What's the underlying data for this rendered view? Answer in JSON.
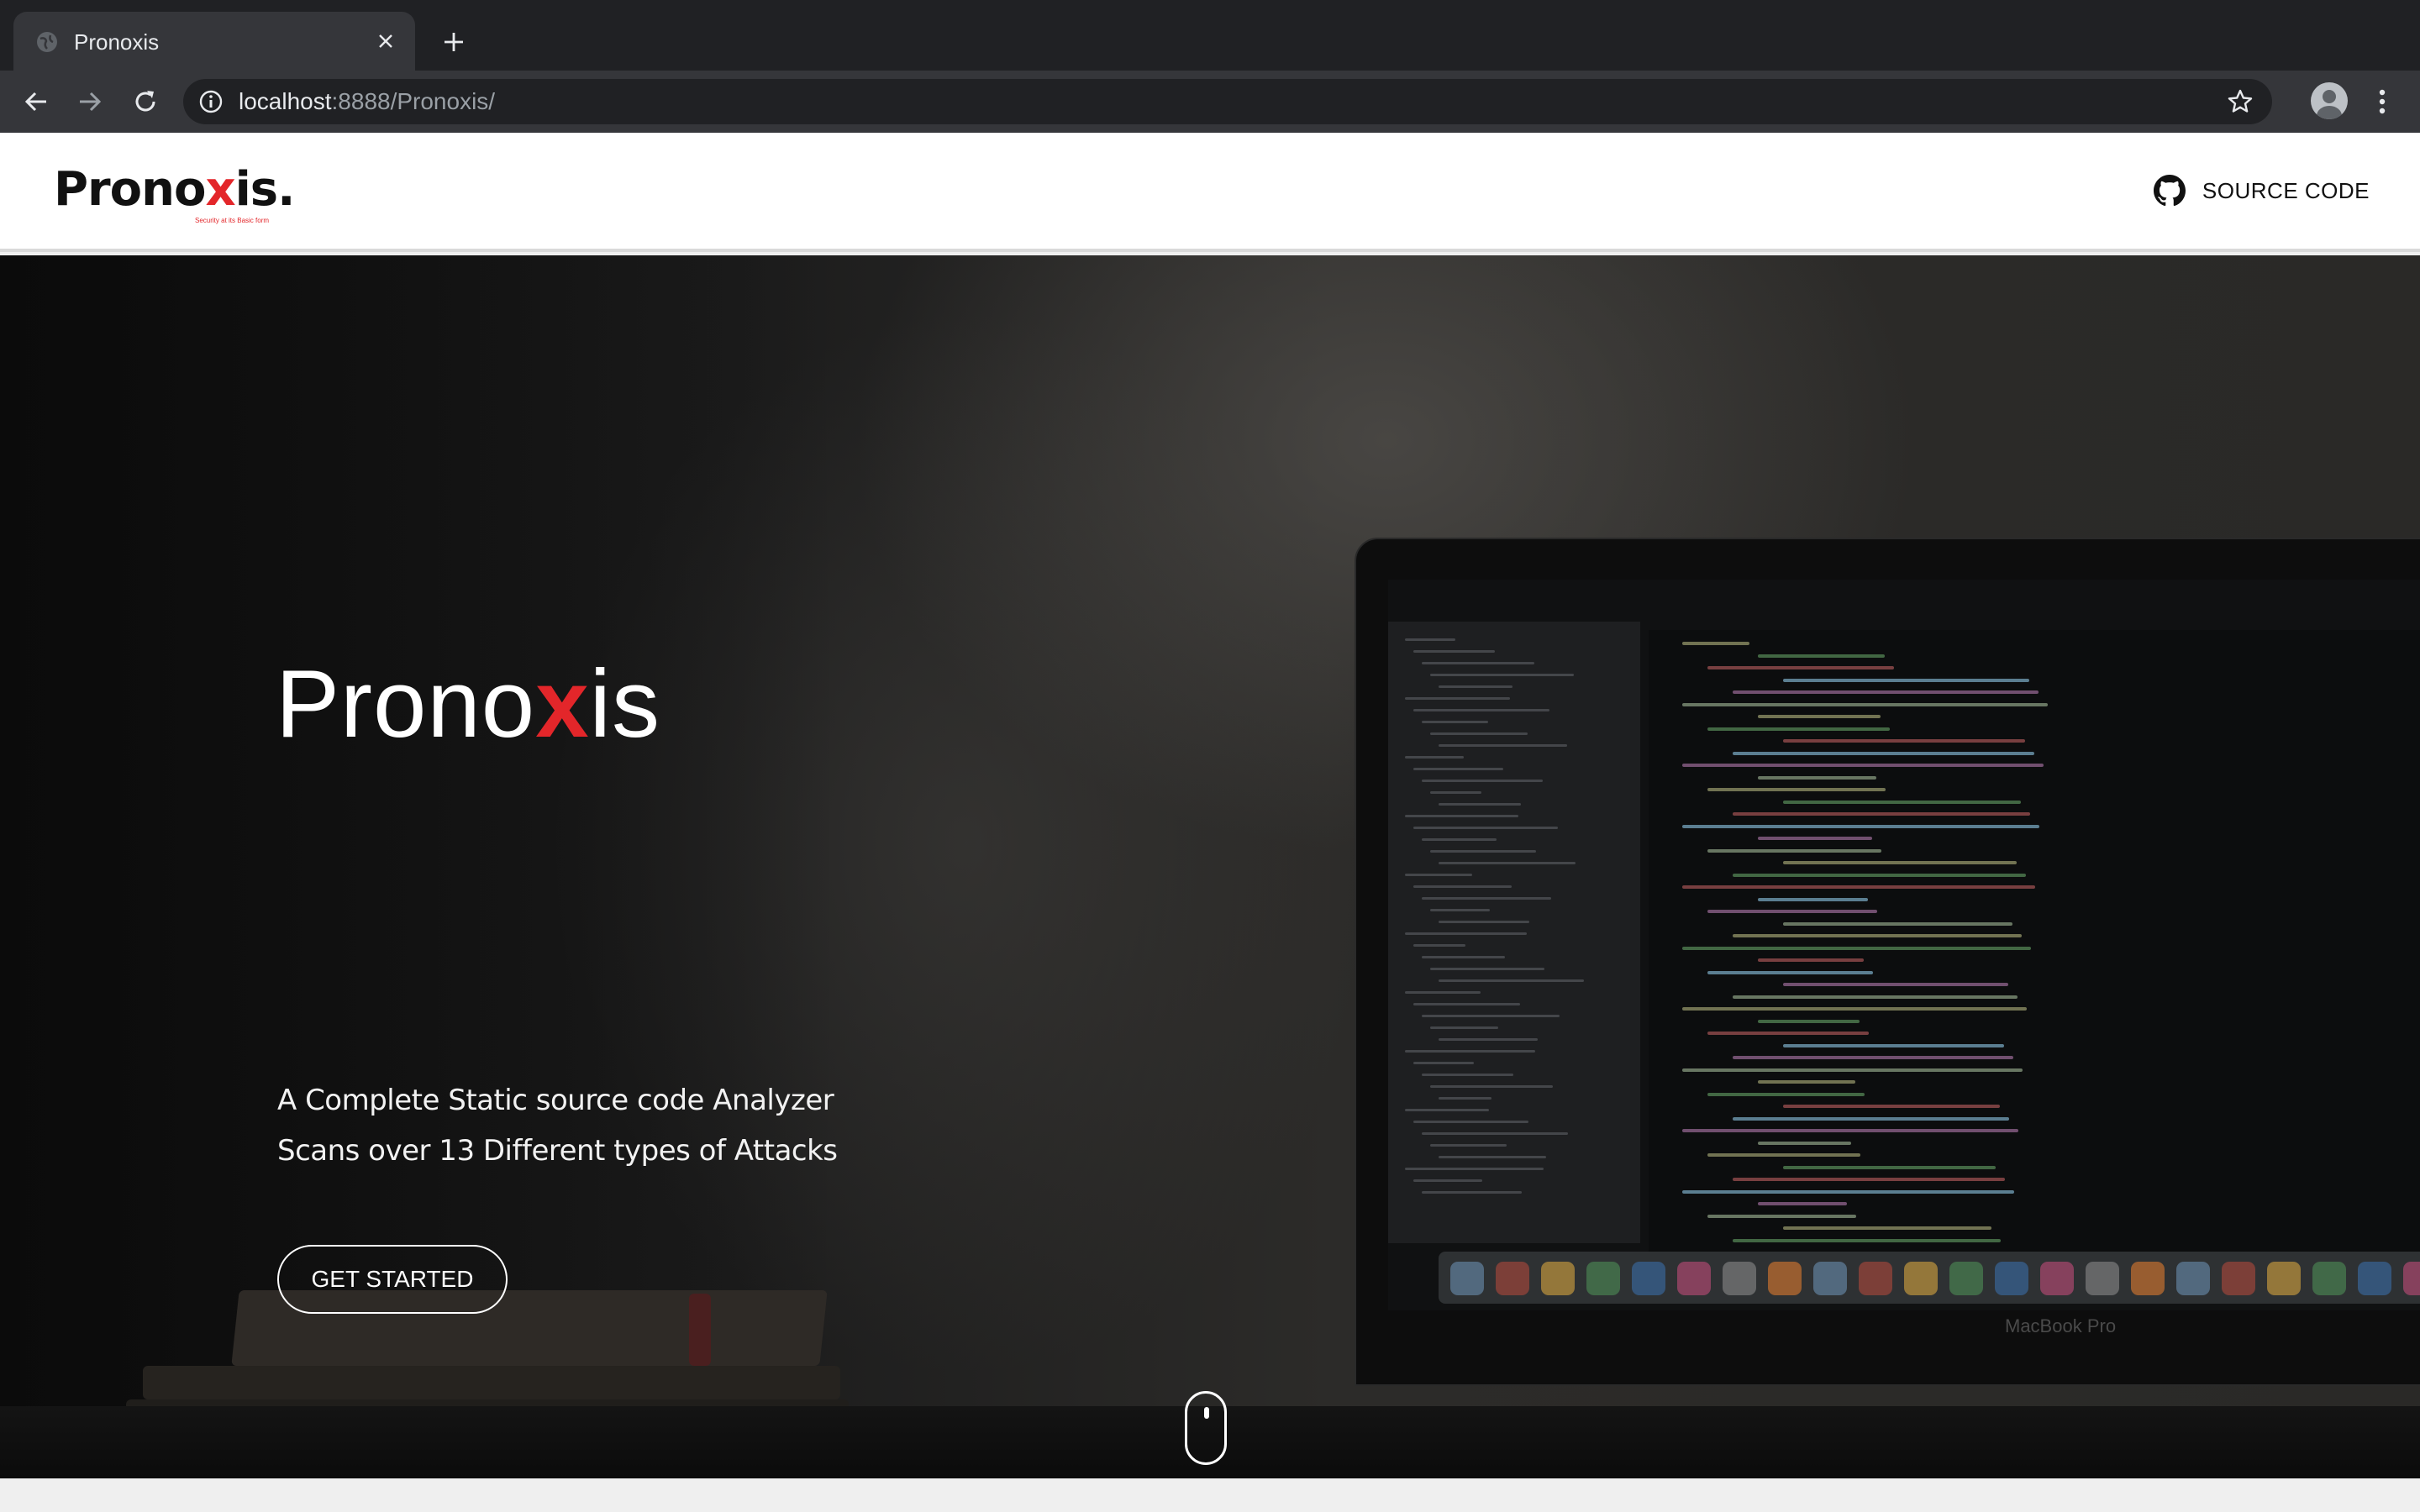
{
  "browser": {
    "tab_title": "Pronoxis",
    "url_host": "localhost",
    "url_rest": ":8888/Pronoxis/",
    "icons": [
      "globe-icon",
      "close-icon",
      "plus-icon",
      "back-arrow-icon",
      "forward-arrow-icon",
      "reload-icon",
      "info-icon",
      "star-icon",
      "profile-avatar",
      "more-vert-icon"
    ]
  },
  "navbar": {
    "logo": "Pronoxis.",
    "logo_tagline": "Security at its Basic form",
    "source_code_label": "SOURCE CODE",
    "source_icon": "github-icon"
  },
  "hero": {
    "title_pre": "Pronox",
    "title_x": "x",
    "title_post": "is",
    "line1": "A Complete Static source code Analyzer",
    "line2": "Scans over 13 Different types of Attacks",
    "cta_label": "GET STARTED",
    "scroll_icon": "mouse-scroll-icon",
    "background_brand": "MacBook Pro"
  },
  "colors": {
    "accent": "#e3262a",
    "chrome_dark": "#202124",
    "chrome_tab": "#35363a"
  }
}
